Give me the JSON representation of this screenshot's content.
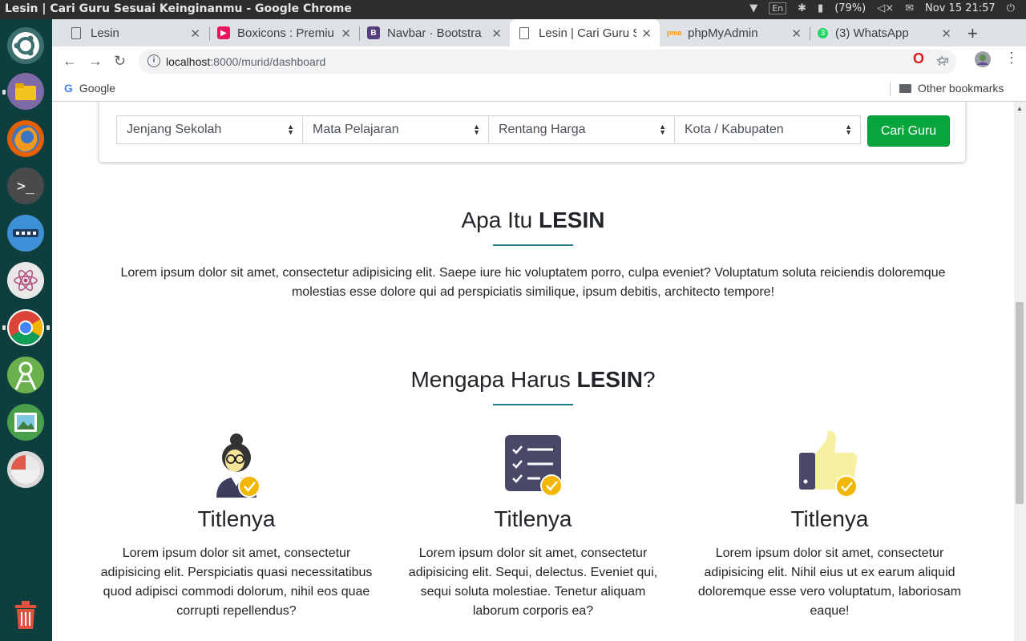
{
  "window": {
    "title": "Lesin | Cari Guru Sesuai Keinginanmu - Google Chrome"
  },
  "system": {
    "battery": "(79%)",
    "datetime": "Nov 15 21:57"
  },
  "tabs": [
    {
      "label": "Lesin"
    },
    {
      "label": "Boxicons : Premiu"
    },
    {
      "label": "Navbar · Bootstra"
    },
    {
      "label": "Lesin | Cari Guru S"
    },
    {
      "label": "phpMyAdmin"
    },
    {
      "label": "(3) WhatsApp"
    }
  ],
  "address": {
    "host": "localhost",
    "path": ":8000/murid/dashboard"
  },
  "bookmarks": {
    "google": "Google",
    "other": "Other bookmarks"
  },
  "search": {
    "jenjang": "Jenjang Sekolah",
    "mapel": "Mata Pelajaran",
    "harga": "Rentang Harga",
    "kota": "Kota / Kabupaten",
    "button": "Cari Guru"
  },
  "about": {
    "title_plain": "Apa Itu ",
    "title_bold": "LESIN",
    "text": "Lorem ipsum dolor sit amet, consectetur adipisicing elit. Saepe iure hic voluptatem porro, culpa eveniet? Voluptatum soluta reiciendis doloremque molestias esse dolore qui ad perspiciatis similique, ipsum debitis, architecto tempore!"
  },
  "why": {
    "title_plain": "Mengapa Harus ",
    "title_bold": "LESIN",
    "title_suffix": "?",
    "features": [
      {
        "title": "Titlenya",
        "text": "Lorem ipsum dolor sit amet, consectetur adipisicing elit. Perspiciatis quasi necessitatibus quod adipisci commodi dolorum, nihil eos quae corrupti repellendus?"
      },
      {
        "title": "Titlenya",
        "text": "Lorem ipsum dolor sit amet, consectetur adipisicing elit. Sequi, delectus. Eveniet qui, sequi soluta molestiae. Tenetur aliquam laborum corporis ea?"
      },
      {
        "title": "Titlenya",
        "text": "Lorem ipsum dolor sit amet, consectetur adipisicing elit. Nihil eius ut ex earum aliquid doloremque esse vero voluptatum, laboriosam eaque!"
      }
    ]
  },
  "colors": {
    "accent": "#1f7a8c",
    "button": "#08a53d",
    "launcher": "#0e3f3e"
  }
}
